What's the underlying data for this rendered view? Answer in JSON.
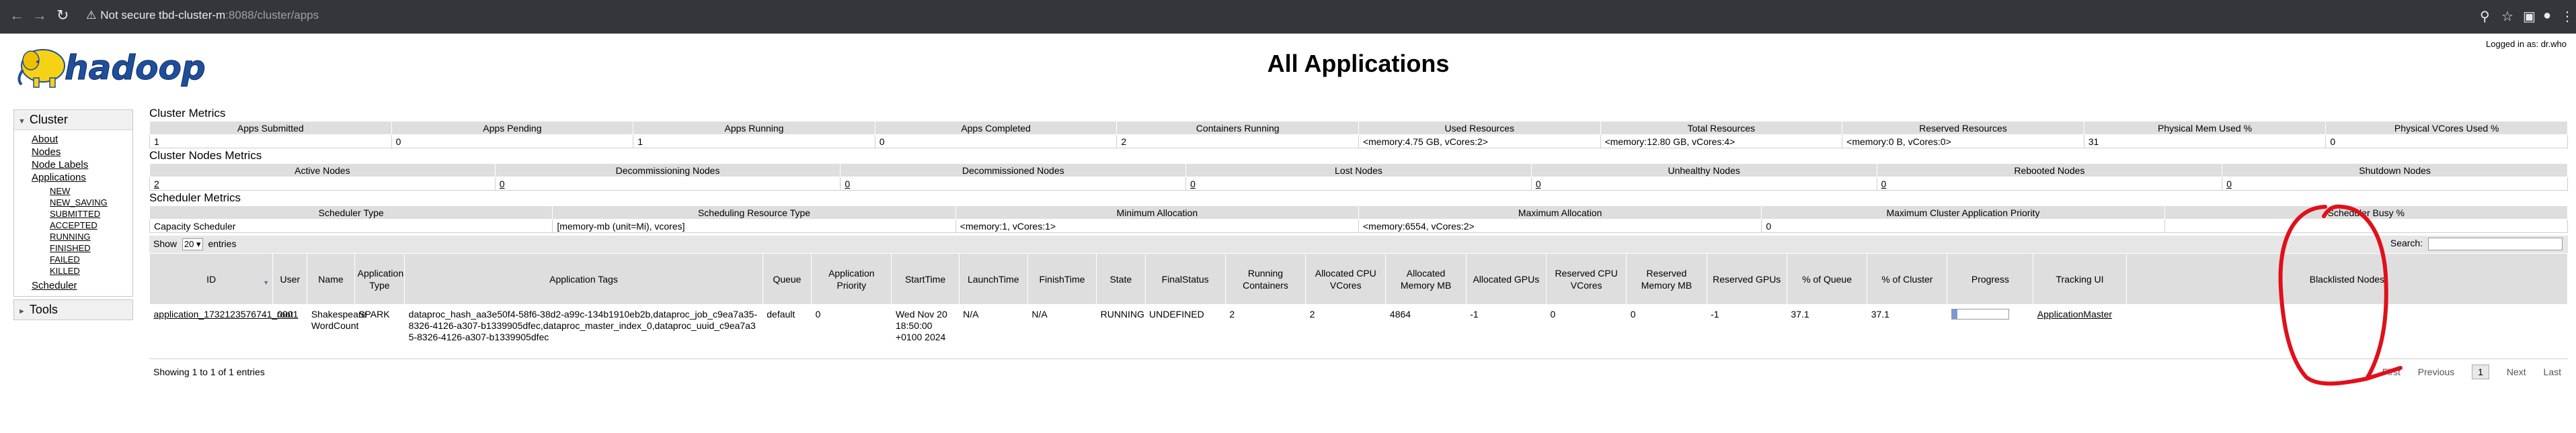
{
  "browser": {
    "security_label": "Not secure",
    "url_host": "tbd-cluster-m",
    "url_path": ":8088/cluster/apps"
  },
  "header": {
    "logo_text": "hadoop",
    "title": "All Applications",
    "logged_in": "Logged in as: dr.who"
  },
  "sidebar": {
    "cluster_label": "Cluster",
    "items": [
      "About",
      "Nodes",
      "Node Labels",
      "Applications"
    ],
    "app_states": [
      "NEW",
      "NEW_SAVING",
      "SUBMITTED",
      "ACCEPTED",
      "RUNNING",
      "FINISHED",
      "FAILED",
      "KILLED"
    ],
    "scheduler_label": "Scheduler",
    "tools_label": "Tools"
  },
  "cluster_metrics": {
    "title": "Cluster Metrics",
    "headers": [
      "Apps Submitted",
      "Apps Pending",
      "Apps Running",
      "Apps Completed",
      "Containers Running",
      "Used Resources",
      "Total Resources",
      "Reserved Resources",
      "Physical Mem Used %",
      "Physical VCores Used %"
    ],
    "values": [
      "1",
      "0",
      "1",
      "0",
      "2",
      "<memory:4.75 GB, vCores:2>",
      "<memory:12.80 GB, vCores:4>",
      "<memory:0 B, vCores:0>",
      "31",
      "0"
    ]
  },
  "node_metrics": {
    "title": "Cluster Nodes Metrics",
    "headers": [
      "Active Nodes",
      "Decommissioning Nodes",
      "Decommissioned Nodes",
      "Lost Nodes",
      "Unhealthy Nodes",
      "Rebooted Nodes",
      "Shutdown Nodes"
    ],
    "values": [
      "2",
      "0",
      "0",
      "0",
      "0",
      "0",
      "0"
    ]
  },
  "scheduler_metrics": {
    "title": "Scheduler Metrics",
    "headers": [
      "Scheduler Type",
      "Scheduling Resource Type",
      "Minimum Allocation",
      "Maximum Allocation",
      "Maximum Cluster Application Priority",
      "Scheduler Busy %"
    ],
    "values": [
      "Capacity Scheduler",
      "[memory-mb (unit=Mi), vcores]",
      "<memory:1, vCores:1>",
      "<memory:6554, vCores:2>",
      "0",
      ""
    ]
  },
  "table_controls": {
    "show_label": "Show",
    "page_size": "20",
    "entries_label": "entries",
    "search_label": "Search:"
  },
  "apps_table": {
    "headers": [
      "ID",
      "User",
      "Name",
      "Application Type",
      "Application Tags",
      "Queue",
      "Application Priority",
      "StartTime",
      "LaunchTime",
      "FinishTime",
      "State",
      "FinalStatus",
      "Running Containers",
      "Allocated CPU VCores",
      "Allocated Memory MB",
      "Allocated GPUs",
      "Reserved CPU VCores",
      "Reserved Memory MB",
      "Reserved GPUs",
      "% of Queue",
      "% of Cluster",
      "Progress",
      "Tracking UI",
      "Blacklisted Nodes"
    ],
    "rows": [
      {
        "id": "application_1732123576741_0001",
        "user": "root",
        "name": "Shakespeare WordCount",
        "type": "SPARK",
        "tags": "dataproc_hash_aa3e50f4-58f6-38d2-a99c-134b1910eb2b,dataproc_job_c9ea7a35-8326-4126-a307-b1339905dfec,dataproc_master_index_0,dataproc_uuid_c9ea7a35-8326-4126-a307-b1339905dfec",
        "queue": "default",
        "priority": "0",
        "start_time": "Wed Nov 20 18:50:00 +0100 2024",
        "launch_time": "N/A",
        "finish_time": "N/A",
        "state": "RUNNING",
        "final_status": "UNDEFINED",
        "running_containers": "2",
        "alloc_vcores": "2",
        "alloc_mem": "4864",
        "alloc_gpus": "-1",
        "res_vcores": "0",
        "res_mem": "0",
        "res_gpus": "-1",
        "pct_queue": "37.1",
        "pct_cluster": "37.1",
        "progress_fraction": 0.1,
        "tracking_ui": "ApplicationMaster",
        "blacklisted": ""
      }
    ]
  },
  "footer": {
    "info": "Showing 1 to 1 of 1 entries",
    "first": "First",
    "previous": "Previous",
    "page": "1",
    "next": "Next",
    "last": "Last"
  },
  "colors": {
    "chrome_bar": "#35363a",
    "header_cell": "#dedede",
    "annotation": "#e0101b",
    "logo_yellow": "#f6d216",
    "logo_blue": "#1f4f9c"
  }
}
